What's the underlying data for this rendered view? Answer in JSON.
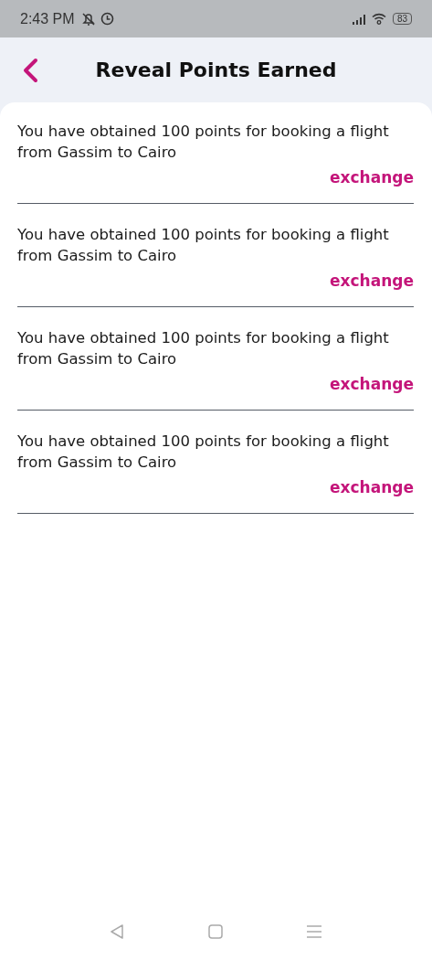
{
  "status_bar": {
    "time": "2:43 PM",
    "battery": "83"
  },
  "header": {
    "title": "Reveal Points Earned"
  },
  "entries": [
    {
      "message": "You have obtained 100 points for booking a flight from Gassim to Cairo",
      "action": "exchange"
    },
    {
      "message": "You have obtained 100 points for booking a flight from Gassim to Cairo",
      "action": "exchange"
    },
    {
      "message": "You have obtained 100 points for booking a flight from Gassim to Cairo",
      "action": "exchange"
    },
    {
      "message": "You have obtained 100 points for booking a flight from Gassim to Cairo",
      "action": "exchange"
    }
  ]
}
